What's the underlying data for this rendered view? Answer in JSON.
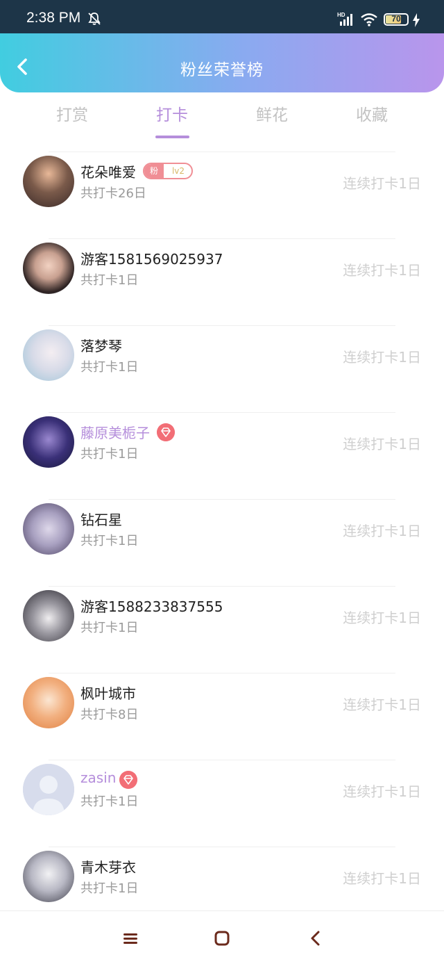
{
  "status_bar": {
    "time": "2:38 PM",
    "battery": "70",
    "icons": [
      "bell-off-icon",
      "signal-icon",
      "wifi-icon",
      "battery-icon",
      "charging-icon"
    ]
  },
  "header": {
    "title": "粉丝荣誉榜",
    "back_icon": "chevron-left-icon"
  },
  "tabs": [
    {
      "label": "打赏",
      "active": false
    },
    {
      "label": "打卡",
      "active": true
    },
    {
      "label": "鲜花",
      "active": false
    },
    {
      "label": "收藏",
      "active": false
    }
  ],
  "colors": {
    "accent": "#b58edb",
    "header_gradient_start": "#41cde0",
    "header_gradient_end": "#b995ec",
    "badge_red": "#f26e76"
  },
  "fan_badge": {
    "label": "粉",
    "level": "lv2"
  },
  "users": [
    {
      "name": "花朵唯爱",
      "total": "共打卡26日",
      "streak": "连续打卡1日",
      "badge": "fan",
      "vip": false
    },
    {
      "name": "游客1581569025937",
      "total": "共打卡1日",
      "streak": "连续打卡1日",
      "badge": "",
      "vip": false
    },
    {
      "name": "落梦琴",
      "total": "共打卡1日",
      "streak": "连续打卡1日",
      "badge": "",
      "vip": false
    },
    {
      "name": "藤原美栀子",
      "total": "共打卡1日",
      "streak": "连续打卡1日",
      "badge": "diamond",
      "vip": true
    },
    {
      "name": "钻石星",
      "total": "共打卡1日",
      "streak": "连续打卡1日",
      "badge": "",
      "vip": false
    },
    {
      "name": "游客1588233837555",
      "total": "共打卡1日",
      "streak": "连续打卡1日",
      "badge": "",
      "vip": false
    },
    {
      "name": "枫叶城市",
      "total": "共打卡8日",
      "streak": "连续打卡1日",
      "badge": "",
      "vip": false
    },
    {
      "name": "zasin",
      "total": "共打卡1日",
      "streak": "连续打卡1日",
      "badge": "diamond",
      "vip": true
    },
    {
      "name": "青木芽衣",
      "total": "共打卡1日",
      "streak": "连续打卡1日",
      "badge": "",
      "vip": false
    }
  ],
  "nav_bar": {
    "icons": [
      "menu-icon",
      "home-square-icon",
      "back-arrow-icon"
    ]
  }
}
